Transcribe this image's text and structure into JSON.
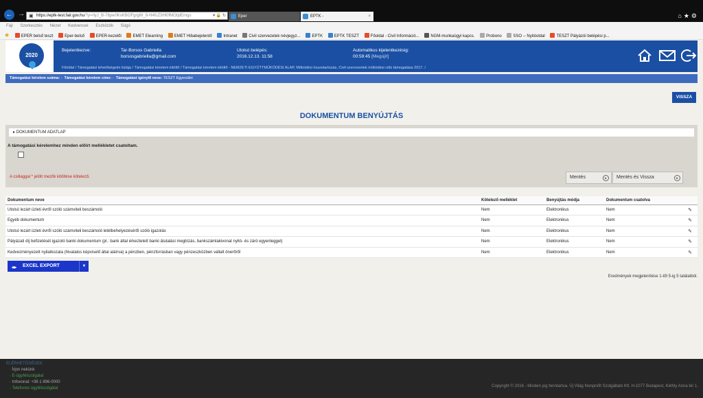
{
  "browser": {
    "url_host": "https://eptk-test.fair.gov.hu",
    "url_rest": "/?p=/lyJ_B-78pw0KxKBOFgrgW_8-H4fcZ3Hl0fMOtjdEmgs",
    "tabs": [
      {
        "label": "Eper"
      },
      {
        "label": "EPTK -",
        "close": "×"
      }
    ],
    "menu": [
      "Fájl",
      "Szerkesztés",
      "Nézet",
      "Kedvencek",
      "Eszközök",
      "Súgó"
    ],
    "favorites": [
      {
        "label": "EPER belső teszt",
        "color": "#e84a2a"
      },
      {
        "label": "Eper-belső",
        "color": "#e84a2a"
      },
      {
        "label": "EPER-kezelői",
        "color": "#e84a2a"
      },
      {
        "label": "EMET Elearning",
        "color": "#e07a1a"
      },
      {
        "label": "EMET Hibabejelentő",
        "color": "#e07a1a"
      },
      {
        "label": "Intranet",
        "color": "#3a7fd1"
      },
      {
        "label": "Civil szervezetek névjegyz...",
        "color": "#777"
      },
      {
        "label": "EPTK",
        "color": "#3a7fd1"
      },
      {
        "label": "EPTK TESZT",
        "color": "#3a7fd1"
      },
      {
        "label": "Főoldal - Civil Információ...",
        "color": "#e84a2a"
      },
      {
        "label": "NGM-munkaügyi kapcs.",
        "color": "#555"
      },
      {
        "label": "Probono",
        "color": "#aaa"
      },
      {
        "label": "SSO -- Nyitóoldal",
        "color": "#aaa"
      },
      {
        "label": "TESZT  Pályázói belépési p...",
        "color": "#e84a2a"
      }
    ]
  },
  "header": {
    "logo_text": "2020",
    "logged_in_label": "Bejelentkezve:",
    "user_name": "Tar-Borsos Gabriella",
    "user_email": "borsosgabriella@gmail.com",
    "last_login_label": "Utolsó belépés:",
    "last_login_value": "2016.12.13. 11:58",
    "auto_logout_label": "Automatikus kijelentkezésig:",
    "auto_logout_value": "00:59:45",
    "auto_logout_link": "[Megújít]"
  },
  "breadcrumb": "Főoldal  /  Támogatási lehetőségeim listája  /  Támogatási kérelem kitöltő  /  Támogatási kérelem kitöltő - NEMZETI EGYÜTTMŰKÖDÉSI ALAP, Működési összetartozás, Civil szervezetek működési célú támogatása 2017.  /",
  "info_strip": {
    "number_label": "Támogatási kérelem száma:",
    "number_value": "-",
    "title_label": "Támogatási kérelem címe:",
    "title_value": "-",
    "applicant_label": "Támogatást igénylő neve:",
    "applicant_value": "TESZT Egyesület"
  },
  "back_button": "VISSZA",
  "page_title": "DOKUMENTUM BENYÚJTÁS",
  "form": {
    "section_label": "DOKUMENTUM ADATLAP",
    "confirm_text": "A támogatási kérelemhez minden előírt mellékletet csatoltam.",
    "required_note": "A csillaggal * jelölt mezők kitöltése kötelező.",
    "save_label": "Mentés",
    "save_back_label": "Mentés és Vissza"
  },
  "table": {
    "columns": [
      "Dokumentum neve",
      "Kötelező melléklet",
      "Benyújtás módja",
      "Dokumentum csatolva"
    ],
    "rows": [
      [
        "Utolsó lezárt üzleti évről szóló számviteli beszámoló",
        "Nem",
        "Elektronikus",
        "Nem"
      ],
      [
        "Egyéb dokumentum",
        "Nem",
        "Elektronikus",
        "Nem"
      ],
      [
        "Utolsó lezárt üzleti évről szóló számviteli beszámoló letétbehelyezéséről szóló igazolás",
        "Nem",
        "Elektronikus",
        "Nem"
      ],
      [
        "Pályázati díj befizetését igazoló banki dokumentum (pl.: bank által érkeztetett banki átutalási megbízás, bankszámlakivonat nyitó- és záró egyenleggel)",
        "Nem",
        "Elektronikus",
        "Nem"
      ],
      [
        "Kedvezményezett nyilatkozata (hivatalos képviselő által aláírva) a pénzben, pénzforrásban vagy pénzeszközben vállalt önerőről",
        "Nem",
        "Elektronikus",
        "Nem"
      ]
    ]
  },
  "excel_export": "EXCEL EXPORT",
  "results_text": "Eredmények megjelenítése 1-től 5-ig 5 találatból.",
  "footer": {
    "heading": "ELÉRHETŐSÉGEK",
    "links": [
      "Írjon nekünk",
      "E-ügyfélszolgálat",
      "Infovonal: +36 1 896-0000",
      "Telefonos ügyfélszolgálat"
    ],
    "copyright": "Copyright © 2016 - Minden jog fenntartva. Új Világ Nonprofit Szolgáltató Kft. H-1077 Budapest, Kéthly Anna tér 1."
  }
}
